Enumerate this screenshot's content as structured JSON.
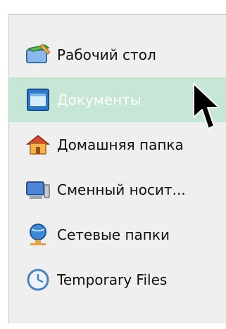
{
  "places": {
    "items": [
      {
        "label": "Рабочий стол",
        "icon": "desktop-icon"
      },
      {
        "label": "Документы",
        "icon": "documents-icon",
        "selected": true
      },
      {
        "label": "Домашняя папка",
        "icon": "home-folder-icon"
      },
      {
        "label": "Сменный носит...",
        "icon": "removable-drive-icon"
      },
      {
        "label": "Сетевые папки",
        "icon": "network-folder-icon"
      },
      {
        "label": "Temporary Files",
        "icon": "clock-icon"
      }
    ]
  },
  "colors": {
    "panel_bg": "#efefef",
    "selected_bg": "#c6e7d5",
    "selected_text": "#ffffff",
    "text": "#111111"
  }
}
